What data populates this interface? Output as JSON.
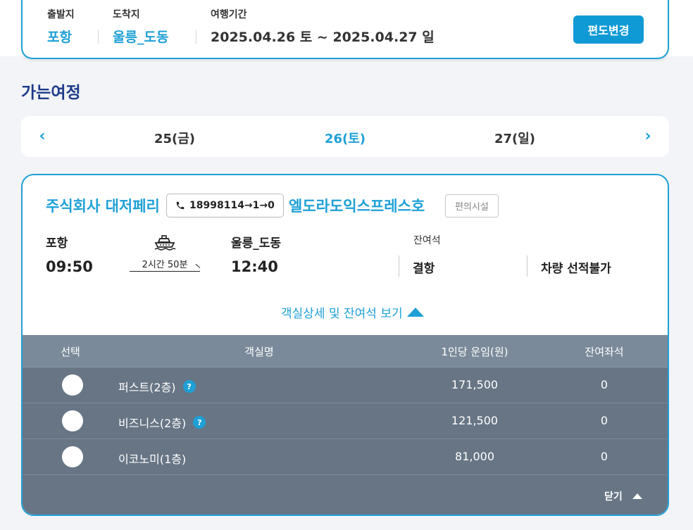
{
  "route": {
    "departure_label": "출발지",
    "departure_value": "포항",
    "arrival_label": "도착지",
    "arrival_value": "울릉_도동",
    "period_label": "여행기간",
    "period_value": "2025.04.26 토 ~ 2025.04.27 일",
    "change_button": "편도변경"
  },
  "section_title": "가는여정",
  "dates": {
    "prev_icon": "chevron-left-icon",
    "next_icon": "chevron-right-icon",
    "items": [
      {
        "label": "25(금)",
        "active": false
      },
      {
        "label": "26(토)",
        "active": true
      },
      {
        "label": "27(일)",
        "active": false
      }
    ]
  },
  "ferry": {
    "company": "주식회사 대저페리",
    "phone": "18998114→1→0",
    "ship_name": "엘도라도익스프레스호",
    "facility_button": "편의시설",
    "origin_port": "포항",
    "origin_time": "09:50",
    "duration": "2시간 50분",
    "dest_port": "울릉_도동",
    "dest_time": "12:40",
    "seat_label": "잔여석",
    "status_1": "결항",
    "status_2": "차량 선적불가",
    "detail_toggle": "객실상세 및 잔여석 보기"
  },
  "cabin_table": {
    "headers": [
      "선택",
      "객실명",
      "1인당 운임(원)",
      "잔여좌석"
    ],
    "rows": [
      {
        "name": "퍼스트(2층)",
        "help": true,
        "fare": "171,500",
        "remain": "0"
      },
      {
        "name": "비즈니스(2층)",
        "help": true,
        "fare": "121,500",
        "remain": "0"
      },
      {
        "name": "이코노미(1층)",
        "help": false,
        "fare": "81,000",
        "remain": "0"
      }
    ],
    "close_label": "닫기"
  },
  "colors": {
    "accent": "#1ea0d6",
    "title_navy": "#1d3a8a",
    "table_bg": "#677585",
    "table_header": "#7a8a9a"
  }
}
